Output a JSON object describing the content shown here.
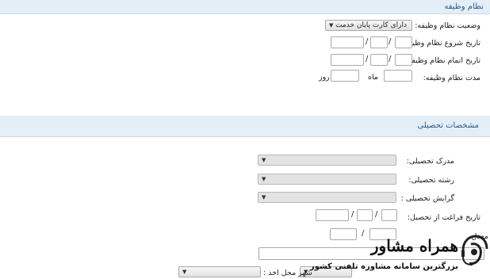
{
  "military": {
    "header": "نظام وظیفه",
    "status_label": "وضعیت نظام وظیفه:",
    "status_value": "دارای کارت پایان خدمت",
    "start_label": "تاریخ شروع نظام وظیفه:",
    "end_label": "تاریخ اتمام نظام وظیفه :",
    "duration_label": "مدت نظام وظیفه:",
    "month_label": "ماه",
    "day_label": "روز",
    "date_separator": "/"
  },
  "education": {
    "header": "مشخصات تحصیلی",
    "degree_label": "مدرک تحصیلی:",
    "field_label": "رشته تحصیلی:",
    "orientation_label": "گرایش تحصیلی :",
    "graduation_label": "تاریخ فراغت از تحصیل:",
    "gpa_label": "معدل",
    "city_label": "شهر محل اخذ :",
    "date_separator": "/"
  },
  "watermark": {
    "brand": "همراه مشاور",
    "tagline": "بزرگترین سامانه مشاوره تلفنی کشور"
  },
  "colors": {
    "header_bg": "#e4eef6",
    "header_text": "#2c5d8a",
    "brand_text": "#111111"
  }
}
